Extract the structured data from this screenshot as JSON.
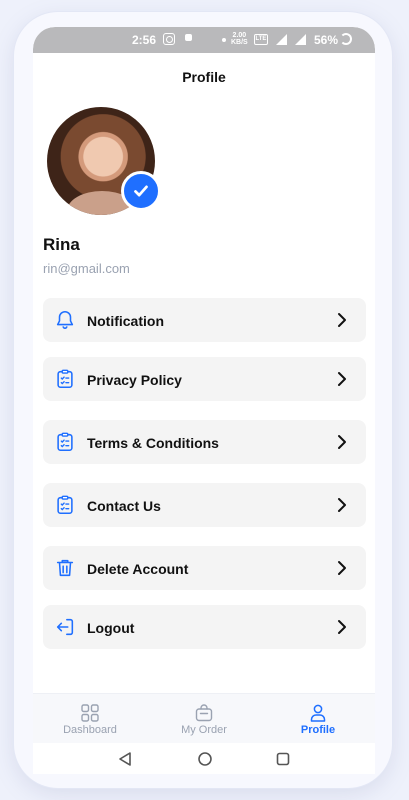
{
  "status_bar": {
    "time": "2:56",
    "speed": "2.00\nKB/S",
    "volte": "Vo\nLTE",
    "battery": "56%"
  },
  "header": {
    "title": "Profile"
  },
  "profile": {
    "name": "Rina",
    "email": "rin@gmail.com"
  },
  "menu": [
    {
      "label": "Notification",
      "icon": "bell-icon"
    },
    {
      "label": "Privacy Policy",
      "icon": "clipboard-list-icon"
    },
    {
      "label": "Terms & Conditions",
      "icon": "clipboard-list-icon"
    },
    {
      "label": "Contact Us",
      "icon": "clipboard-list-icon"
    },
    {
      "label": "Delete Account",
      "icon": "trash-icon"
    },
    {
      "label": "Logout",
      "icon": "logout-icon"
    }
  ],
  "tabs": [
    {
      "label": "Dashboard",
      "icon": "grid-icon",
      "active": false
    },
    {
      "label": "My Order",
      "icon": "bag-icon",
      "active": false
    },
    {
      "label": "Profile",
      "icon": "user-icon",
      "active": true
    }
  ],
  "colors": {
    "accent": "#1f6fff",
    "item_bg": "#f4f4f4",
    "muted": "#9aa2b1"
  }
}
